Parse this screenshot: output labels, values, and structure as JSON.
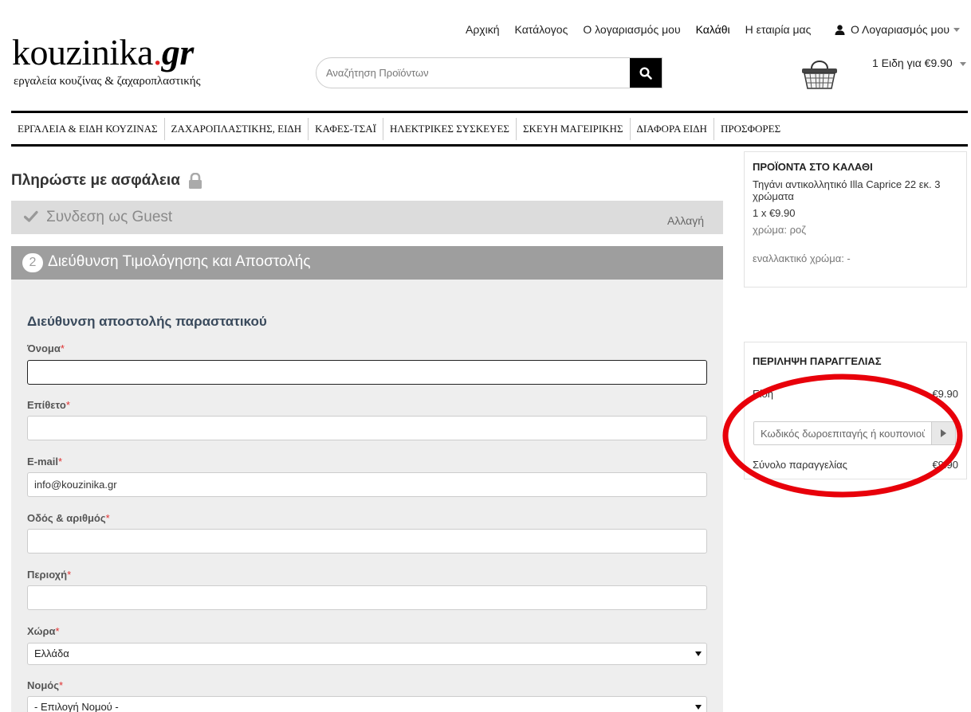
{
  "logo": {
    "name": "kouzinika",
    "dot": ".",
    "tld": "gr",
    "tagline": "εργαλεία κουζίνας & ζαχαροπλαστικής"
  },
  "top_links": [
    "Αρχική",
    "Κατάλογος",
    "Ο λογαριασμός μου",
    "Καλάθι",
    "Η εταιρία μας"
  ],
  "account": {
    "label": "Ο Λογαριασμός μου"
  },
  "search": {
    "placeholder": "Αναζήτηση Προϊόντων"
  },
  "cart": {
    "summary": "1 Ειδη για €9.90"
  },
  "nav": [
    "ΕΡΓΑΛΕΙΑ & ΕΙΔΗ ΚΟΥΖΙΝΑΣ",
    "ΖΑΧΑΡΟΠΛΑΣΤΙΚΗΣ, ΕΙΔΗ",
    "ΚΑΦΕΣ-ΤΣΑΪ",
    "ΗΛΕΚΤΡΙΚΕΣ ΣΥΣΚΕΥΕΣ",
    "ΣΚΕΥΗ ΜΑΓΕΙΡΙΚΗΣ",
    "ΔΙΑΦΟΡΑ ΕΙΔΗ",
    "ΠΡΟΣΦΟΡΕΣ"
  ],
  "checkout": {
    "title": "Πληρώστε με ασφάλεια",
    "step1": {
      "title": "Συνδεση ως Guest",
      "edit": "Αλλαγή"
    },
    "step2": {
      "number": "2",
      "title": "Διεύθυνση Τιμολόγησης και Αποστολής"
    },
    "form": {
      "heading": "Διεύθυνση αποστολής παραστατικού",
      "first_name": {
        "label": "Όνομα",
        "value": ""
      },
      "last_name": {
        "label": "Επίθετο",
        "value": ""
      },
      "email": {
        "label": "E-mail",
        "value": "info@kouzinika.gr"
      },
      "street": {
        "label": "Οδός & αριθμός",
        "value": ""
      },
      "area": {
        "label": "Περιοχή",
        "value": ""
      },
      "country": {
        "label": "Χώρα",
        "value": "Ελλάδα"
      },
      "prefecture": {
        "label": "Νομός",
        "value": "- Επιλογή Νομού -"
      },
      "required_mark": "*"
    }
  },
  "cart_box": {
    "title": "ΠΡΟΪΟΝΤΑ ΣΤΟ ΚΑΛΑΘΙ",
    "product_name": "Τηγάνι αντικολλητικό Illa Caprice 22 εκ. 3 χρώματα",
    "qty_price": "1 x €9.90",
    "color": "χρώμα: ροζ",
    "alt_color": "εναλλακτικό χρώμα: -"
  },
  "summary_box": {
    "title": "ΠΕΡΙΛΗΨΗ ΠΑΡΑΓΓΕΛΙΑΣ",
    "items_label": "Είδη",
    "items_value": "€9.90",
    "coupon_placeholder": "Κωδικός δωροεπιταγής ή κουπονιού",
    "total_label": "Σύνολο παραγγελίας",
    "total_value": "€9.90"
  },
  "colors": {
    "annotation": "#e8000a",
    "step_active": "#9e9e9e",
    "step_done": "#dcdcdc",
    "panel": "#eeeeee",
    "required": "#e03030"
  }
}
